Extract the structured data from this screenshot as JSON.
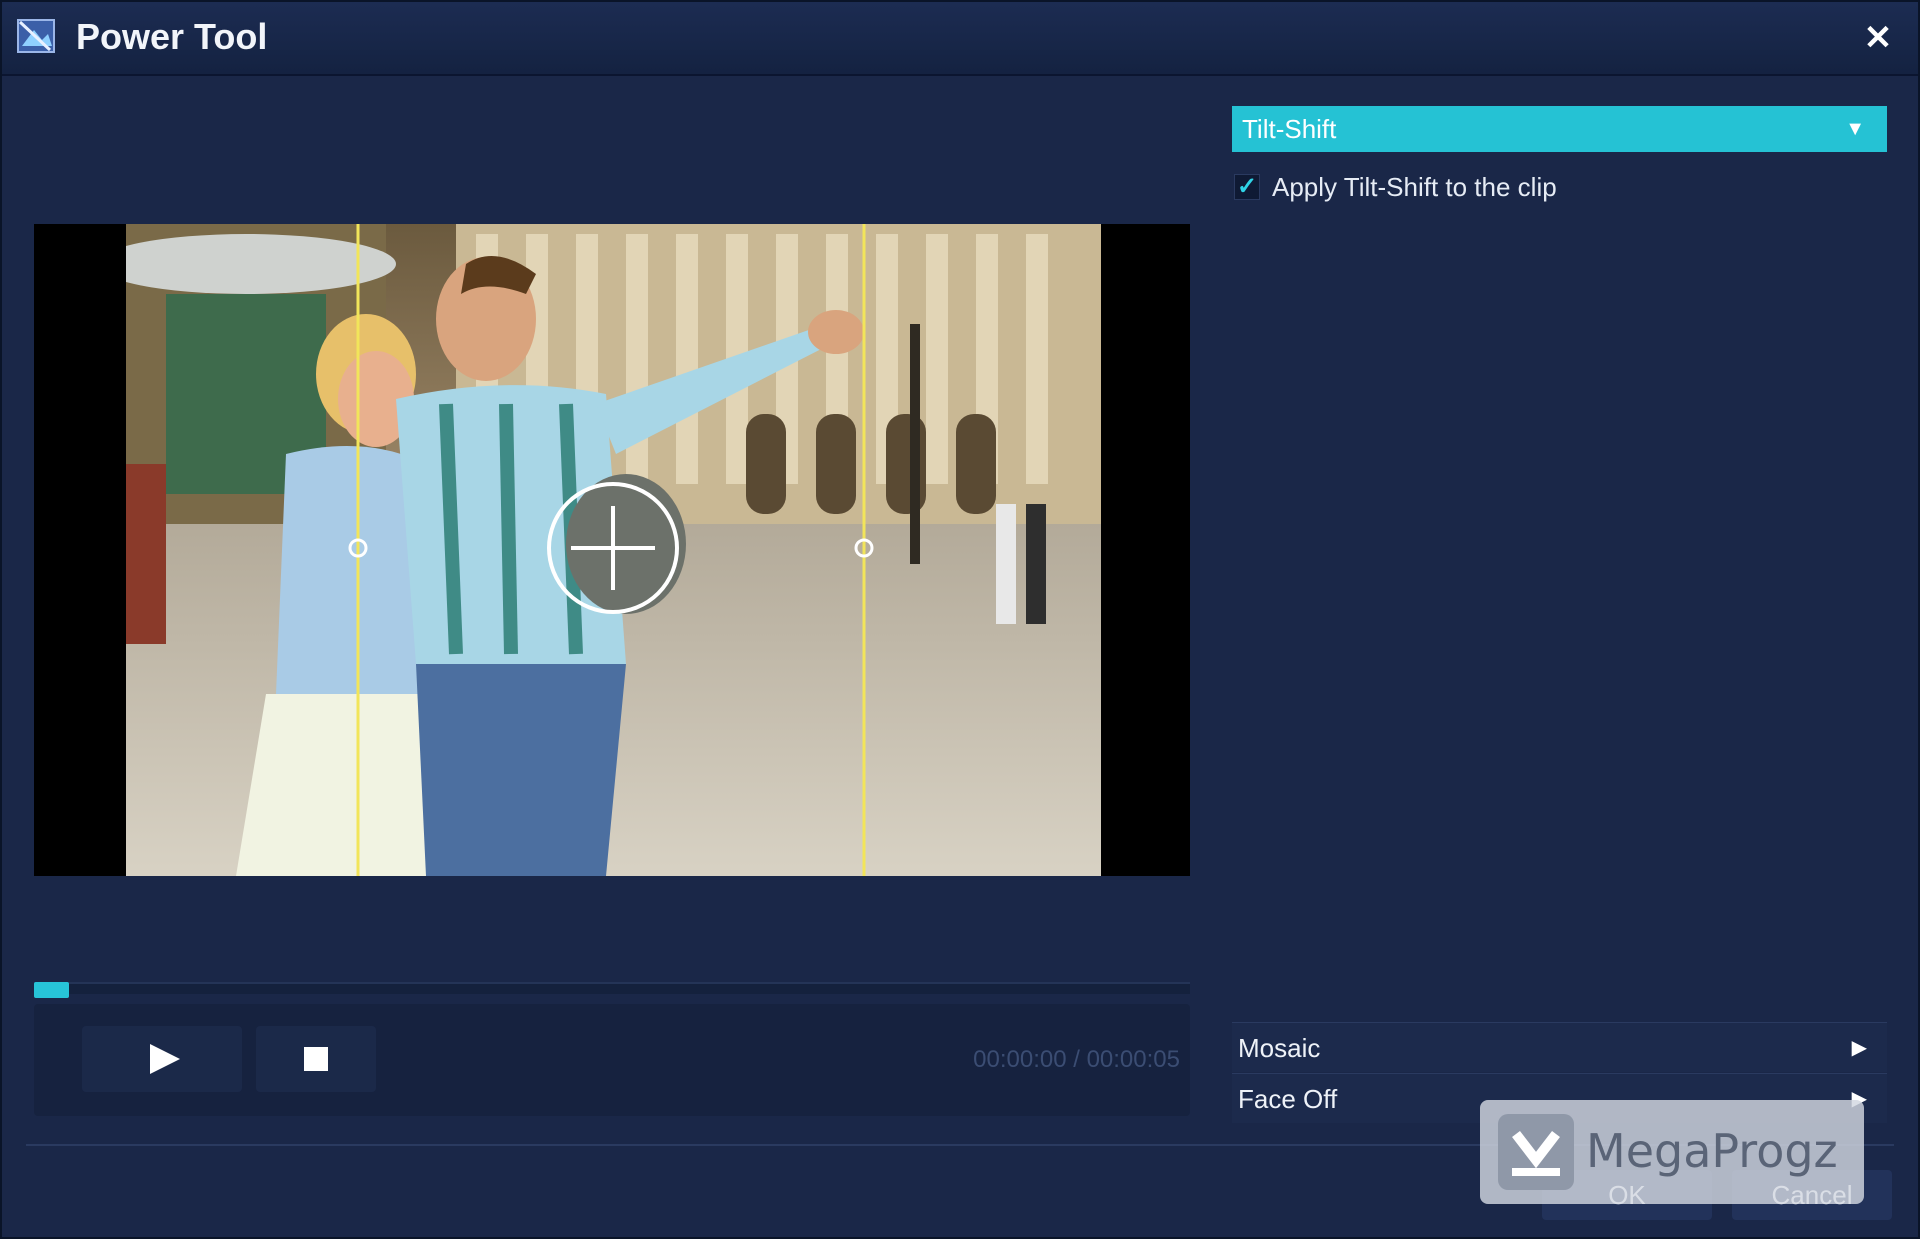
{
  "window": {
    "title": "Power Tool"
  },
  "right_panel": {
    "effect_select": {
      "selected": "Tilt-Shift"
    },
    "apply": {
      "checked": true,
      "label": "Apply Tilt-Shift to the clip"
    },
    "tools": [
      {
        "label": "Mosaic"
      },
      {
        "label": "Face Off"
      }
    ]
  },
  "player": {
    "time": "00:00:00 / 00:00:05",
    "progress": 0.03
  },
  "footer": {
    "ok_label": "OK",
    "cancel_label": "Cancel"
  },
  "watermark": {
    "text": "MegaProgz"
  },
  "colors": {
    "accent": "#25c2d4",
    "tilt_line": "#f2e55a"
  },
  "icons": [
    "app-icon",
    "close-icon",
    "play-icon",
    "stop-icon",
    "checkmark-icon",
    "chevron-down-icon",
    "chevron-right-icon"
  ]
}
